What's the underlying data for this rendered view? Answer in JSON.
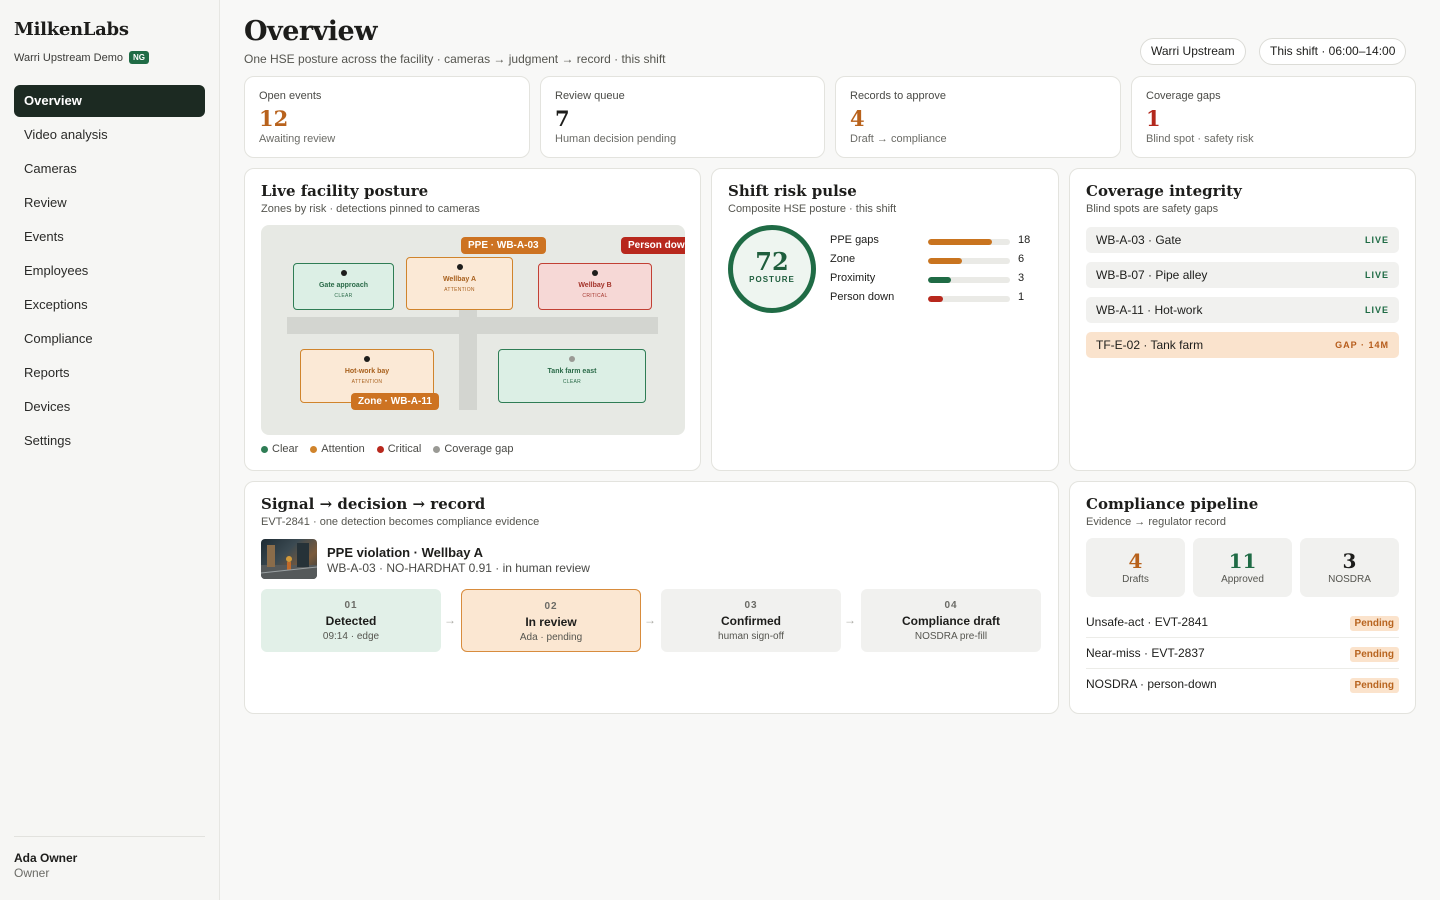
{
  "sidebar": {
    "brand": "MilkenLabs",
    "org": "Warri Upstream Demo",
    "org_badge": "NG",
    "nav": [
      {
        "label": "Overview",
        "active": true
      },
      {
        "label": "Video analysis"
      },
      {
        "label": "Cameras"
      },
      {
        "label": "Review"
      },
      {
        "label": "Events"
      },
      {
        "label": "Employees"
      },
      {
        "label": "Exceptions"
      },
      {
        "label": "Compliance"
      },
      {
        "label": "Reports"
      },
      {
        "label": "Devices"
      },
      {
        "label": "Settings"
      }
    ],
    "user": {
      "name": "Ada Owner",
      "role": "Owner"
    }
  },
  "header": {
    "title": "Overview",
    "subtitle": "One HSE posture across the facility · cameras → judgment → record · this shift",
    "site_pill": "Warri Upstream",
    "shift_pill": "This shift · 06:00–14:00"
  },
  "kpis": [
    {
      "label": "Open events",
      "value": "12",
      "sub": "Awaiting review",
      "color": "#b8621c"
    },
    {
      "label": "Review queue",
      "value": "7",
      "sub": "Human decision pending",
      "color": "#1d1d1b"
    },
    {
      "label": "Records to approve",
      "value": "4",
      "sub": "Draft → compliance",
      "color": "#b8621c"
    },
    {
      "label": "Coverage gaps",
      "value": "1",
      "sub": "Blind spot · safety risk",
      "color": "#b3281d"
    }
  ],
  "posture": {
    "title": "Live facility posture",
    "subtitle": "Zones by risk · detections pinned to cameras",
    "zones": [
      {
        "name": "Gate approach",
        "status": "CLEAR"
      },
      {
        "name": "Wellbay A",
        "status": "ATTENTION"
      },
      {
        "name": "Wellbay B",
        "status": "CRITICAL"
      },
      {
        "name": "Hot-work bay",
        "status": "ATTENTION"
      },
      {
        "name": "Tank farm east",
        "status": "CLEAR"
      }
    ],
    "tags": {
      "ppe": "PPE · WB-A-03",
      "person_down": "Person down",
      "zone": "Zone · WB-A-11"
    },
    "legend": [
      {
        "label": "Clear",
        "color": "#2f7d55"
      },
      {
        "label": "Attention",
        "color": "#d0842c"
      },
      {
        "label": "Critical",
        "color": "#b8281d"
      },
      {
        "label": "Coverage gap",
        "color": "#9a9a95"
      }
    ]
  },
  "risk": {
    "title": "Shift risk pulse",
    "subtitle": "Composite HSE posture · this shift",
    "score": "72",
    "score_label": "POSTURE",
    "bars": [
      {
        "label": "PPE gaps",
        "count": "18",
        "fraction": 0.78,
        "color": "#c9741f"
      },
      {
        "label": "Zone",
        "count": "6",
        "fraction": 0.42,
        "color": "#c9741f"
      },
      {
        "label": "Proximity",
        "count": "3",
        "fraction": 0.28,
        "color": "#1f6b45"
      },
      {
        "label": "Person down",
        "count": "1",
        "fraction": 0.18,
        "color": "#b8281d"
      }
    ]
  },
  "coverage": {
    "title": "Coverage integrity",
    "subtitle": "Blind spots are safety gaps",
    "rows": [
      {
        "name": "WB-A-03 · Gate",
        "status": "LIVE"
      },
      {
        "name": "WB-B-07 · Pipe alley",
        "status": "LIVE"
      },
      {
        "name": "WB-A-11 · Hot-work",
        "status": "LIVE"
      },
      {
        "name": "TF-E-02 · Tank farm",
        "status": "GAP · 14M"
      }
    ]
  },
  "signal": {
    "title": "Signal → decision → record",
    "subtitle": "EVT-2841 · one detection becomes compliance evidence",
    "event_title": "PPE violation · Wellbay A",
    "event_sub": "WB-A-03 · NO-HARDHAT 0.91 · in human review",
    "steps": [
      {
        "num": "01",
        "name": "Detected",
        "desc": "09:14 · edge"
      },
      {
        "num": "02",
        "name": "In review",
        "desc": "Ada · pending"
      },
      {
        "num": "03",
        "name": "Confirmed",
        "desc": "human sign-off"
      },
      {
        "num": "04",
        "name": "Compliance draft",
        "desc": "NOSDRA pre-fill"
      }
    ],
    "arrow": "→"
  },
  "compliance": {
    "title": "Compliance pipeline",
    "subtitle": "Evidence → regulator record",
    "tiles": [
      {
        "value": "4",
        "label": "Drafts",
        "color": "#b8621c"
      },
      {
        "value": "11",
        "label": "Approved",
        "color": "#1f6b45"
      },
      {
        "value": "3",
        "label": "NOSDRA",
        "color": "#1d1d1b"
      }
    ],
    "rows": [
      {
        "label": "Unsafe-act · EVT-2841",
        "badge": "Pending"
      },
      {
        "label": "Near-miss · EVT-2837",
        "badge": "Pending"
      },
      {
        "label": "NOSDRA · person-down",
        "badge": "Pending"
      }
    ]
  }
}
